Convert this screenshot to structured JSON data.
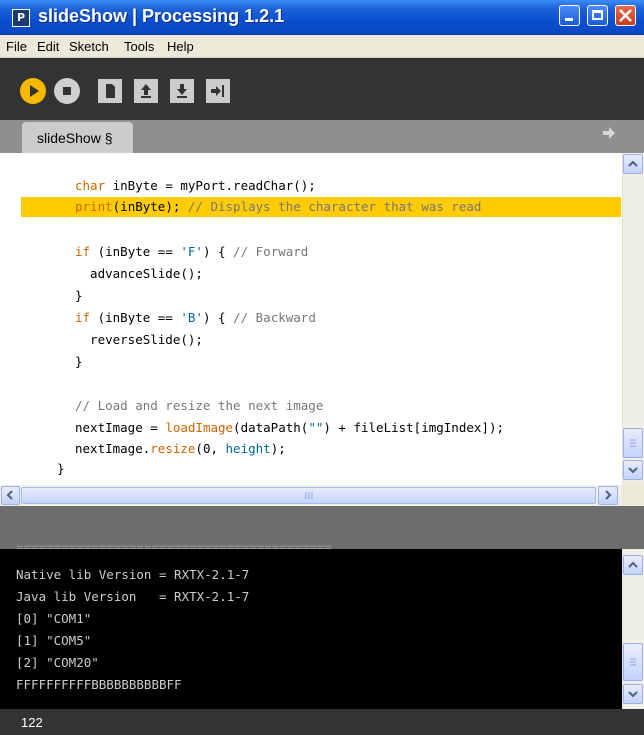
{
  "window": {
    "title": "slideShow | Processing 1.2.1",
    "app_icon_letter": "P"
  },
  "menu": [
    "File",
    "Edit",
    "Sketch",
    "Tools",
    "Help"
  ],
  "toolbar": {
    "buttons": [
      "run-icon",
      "stop-icon",
      "new-file-icon",
      "open-icon",
      "save-icon",
      "export-icon"
    ]
  },
  "tabs": [
    {
      "label": "slideShow §",
      "active": true
    }
  ],
  "editor": {
    "lines": [
      {
        "parts": [
          {
            "t": "char",
            "c": "kw"
          },
          {
            "t": " inByte = myPort.readChar();",
            "c": ""
          }
        ]
      },
      {
        "parts": [
          {
            "t": "print",
            "c": "fn"
          },
          {
            "t": "(inByte); ",
            "c": ""
          },
          {
            "t": "// Displays the character that was read",
            "c": "com"
          }
        ],
        "highlighted": true
      },
      {
        "parts": []
      },
      {
        "parts": [
          {
            "t": "if",
            "c": "kw"
          },
          {
            "t": " (inByte == ",
            "c": ""
          },
          {
            "t": "'F'",
            "c": "str"
          },
          {
            "t": ") { ",
            "c": ""
          },
          {
            "t": "// Forward",
            "c": "com"
          }
        ]
      },
      {
        "parts": [
          {
            "t": "  advanceSlide();",
            "c": ""
          }
        ]
      },
      {
        "parts": [
          {
            "t": "}",
            "c": ""
          }
        ]
      },
      {
        "parts": [
          {
            "t": "if",
            "c": "kw"
          },
          {
            "t": " (inByte == ",
            "c": ""
          },
          {
            "t": "'B'",
            "c": "str"
          },
          {
            "t": ") { ",
            "c": ""
          },
          {
            "t": "// Backward",
            "c": "com"
          }
        ]
      },
      {
        "parts": [
          {
            "t": "  reverseSlide();",
            "c": ""
          }
        ]
      },
      {
        "parts": [
          {
            "t": "}",
            "c": ""
          }
        ]
      },
      {
        "parts": []
      },
      {
        "parts": [
          {
            "t": "// Load and resize the next image",
            "c": "com"
          }
        ]
      },
      {
        "parts": [
          {
            "t": "nextImage = ",
            "c": ""
          },
          {
            "t": "loadImage",
            "c": "fn"
          },
          {
            "t": "(dataPath(",
            "c": ""
          },
          {
            "t": "\"\"",
            "c": "str"
          },
          {
            "t": ") + fileList[imgIndex]);",
            "c": ""
          }
        ]
      },
      {
        "parts": [
          {
            "t": "nextImage.",
            "c": ""
          },
          {
            "t": "resize",
            "c": "fn"
          },
          {
            "t": "(0, ",
            "c": ""
          },
          {
            "t": "height",
            "c": "kb"
          },
          {
            "t": ");",
            "c": ""
          }
        ]
      }
    ],
    "closing_brace": "}"
  },
  "console": {
    "separator": "==========================================",
    "lines": [
      "Native lib Version = RXTX-2.1-7",
      "Java lib Version   = RXTX-2.1-7",
      "[0] \"COM1\"",
      "[1] \"COM5\"",
      "[2] \"COM20\"",
      "FFFFFFFFFFBBBBBBBBBBFF"
    ]
  },
  "status": {
    "line_number": "122"
  },
  "colors": {
    "titlebar": "#0a4fcf",
    "toolbar": "#333333",
    "run_button": "#f9b800",
    "highlight": "#ffcc00",
    "console_bg": "#000000",
    "keyword": "#cc6600",
    "comment": "#777777",
    "string": "#006699"
  }
}
